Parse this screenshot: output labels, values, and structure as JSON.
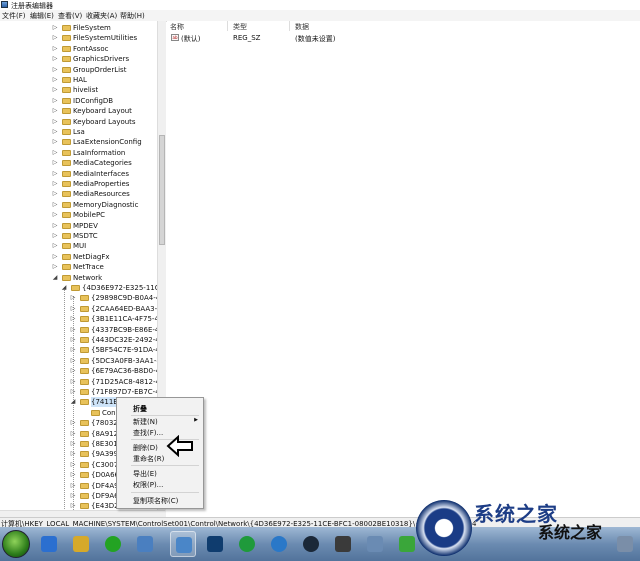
{
  "window": {
    "title": "注册表编辑器"
  },
  "menu": [
    "文件(F)",
    "编辑(E)",
    "查看(V)",
    "收藏夹(A)",
    "帮助(H)"
  ],
  "tree": {
    "top_items": [
      "FileSystem",
      "FileSystemUtilities",
      "FontAssoc",
      "GraphicsDrivers",
      "GroupOrderList",
      "HAL",
      "hivelist",
      "IDConfigDB",
      "Keyboard Layout",
      "Keyboard Layouts",
      "Lsa",
      "LsaExtensionConfig",
      "LsaInformation",
      "MediaCategories",
      "MediaInterfaces",
      "MediaProperties",
      "MediaResources",
      "MemoryDiagnostic",
      "MobilePC",
      "MPDEV",
      "MSDTC",
      "MUI",
      "NetDiagFx",
      "NetTrace",
      "Network"
    ],
    "network_child": "{4D36E972-E325-11CE-B",
    "guid_items": [
      "{29898C9D-B0A4-4FE",
      "{2CAA64ED-BAA3-44",
      "{3B1E11CA-4F75-480",
      "{4337BC9B-E86E-4F7",
      "{443DC32E-2492-41A",
      "{5BF54C7E-91DA-457",
      "{5DC3A0FB-3AA1-4D",
      "{6E79AC36-B8D0-437",
      "{71D25AC8-4812-412",
      "{71F897D7-EB7C-4D8",
      "{7411E17E-59D4-4D4"
    ],
    "selected_child": "Conn",
    "after_items": [
      "{780328",
      "{8A912",
      "{8E301A",
      "{9A399D",
      "{C30076",
      "{D0A66",
      "{DF4A90",
      "{DF9A60",
      "{E43D24"
    ],
    "last_item": "Descriptions"
  },
  "list": {
    "headers": [
      "名称",
      "类型",
      "数据"
    ],
    "rows": [
      {
        "icon": "ab-icon",
        "name": "(默认)",
        "type": "REG_SZ",
        "data": "(数值未设置)"
      }
    ]
  },
  "context_menu": {
    "items": [
      "折叠",
      "新建(N)",
      "查找(F)...",
      "删除(D)",
      "重命名(R)",
      "导出(E)",
      "权限(P)...",
      "复制项名称(C)"
    ],
    "submenu_item_index": 1
  },
  "statusbar": {
    "path": "计算机\\HKEY_LOCAL_MACHINE\\SYSTEM\\ControlSet001\\Control\\Network\\{4D36E972-E325-11CE-BFC1-08002BE10318}\\{7411E17E-59D4"
  },
  "taskbar": {
    "icons": [
      "ie-icon",
      "explorer-icon",
      "media-icon",
      "pin-icon",
      "regedit-icon",
      "photoshop-icon",
      "player-icon",
      "kugou-icon",
      "steam-icon",
      "screen-icon",
      "network-icon",
      "game-icon",
      "settings-icon"
    ],
    "colors": [
      "#2b6fd0",
      "#d6a92a",
      "#23a323",
      "#4a7fc0",
      "#4a86c8",
      "#0f3c6e",
      "#1f9a3b",
      "#2a78c8",
      "#1b2838",
      "#3a3a3a",
      "#6a8bb3",
      "#3aa63a",
      "#7a8ea8"
    ]
  },
  "watermark": {
    "big": "系统之家",
    "text": "系统之家"
  },
  "colors": {
    "selection": "#cde3f8",
    "folder": "#e8c25a",
    "taskbar": "#6b8bb1"
  }
}
